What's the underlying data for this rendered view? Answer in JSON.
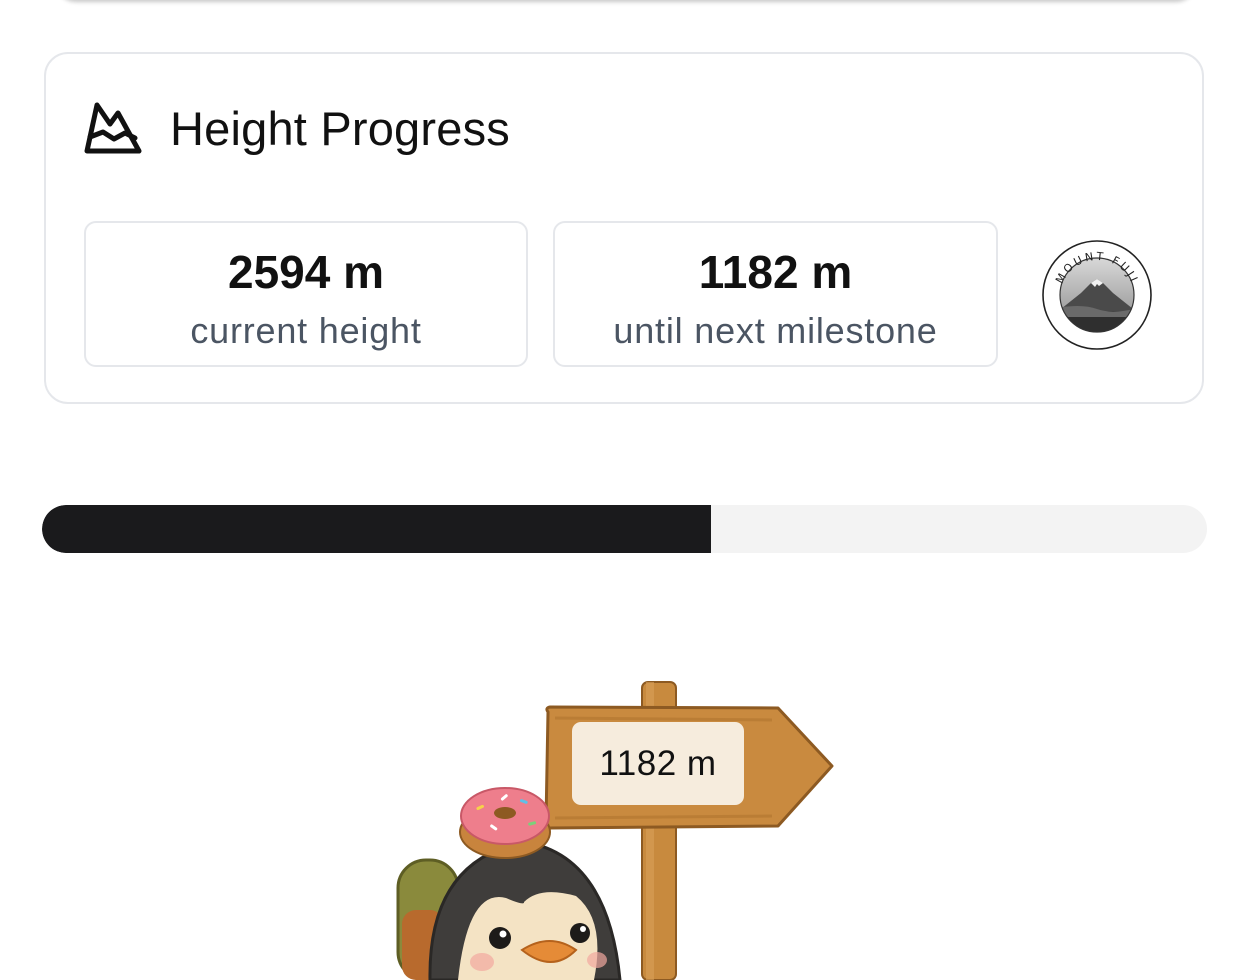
{
  "height_progress": {
    "title": "Height Progress",
    "icon": "mountain-icon",
    "current": {
      "value": "2594 m",
      "label": "current height"
    },
    "next": {
      "value": "1182 m",
      "label": "until next milestone"
    },
    "milestone_badge": {
      "text": "MOUNT FUJI",
      "icon": "mount-fuji-badge"
    }
  },
  "progress_bar": {
    "fraction": 0.574,
    "fill_color": "#1a1a1c",
    "track_color": "#f3f3f3"
  },
  "signpost": {
    "distance_label": "1182 m"
  },
  "colors": {
    "text_primary": "#111111",
    "text_secondary": "#4b5563",
    "border": "#e5e7eb"
  }
}
